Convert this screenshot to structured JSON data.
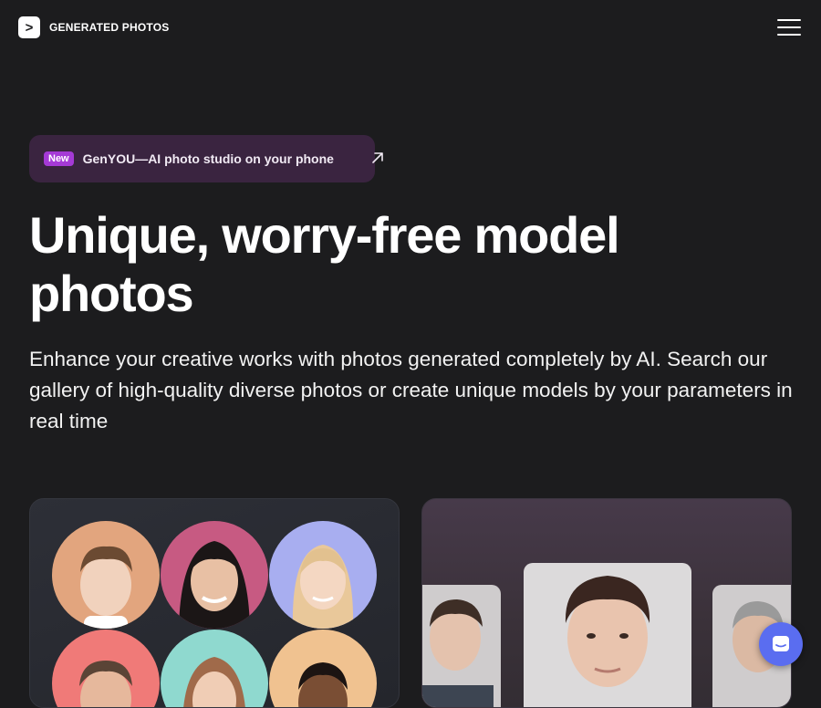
{
  "header": {
    "logo_glyph": ">",
    "brand": "GENERATED PHOTOS",
    "menu_icon": "hamburger-menu-icon"
  },
  "promo": {
    "badge": "New",
    "text": "GenYOU—AI photo studio on your phone",
    "icon": "arrow-up-right-icon"
  },
  "hero": {
    "title": "Unique, worry-free model photos",
    "subtitle": "Enhance your creative works with photos generated completely by AI. Search our gallery of high-quality diverse photos or create unique models by your parameters in real time"
  },
  "cards": {
    "gallery": {
      "faces": [
        {
          "bg": "#e2a57e"
        },
        {
          "bg": "#c75a82"
        },
        {
          "bg": "#a8aef0"
        },
        {
          "bg": "#f07a78"
        },
        {
          "bg": "#8fd9cf"
        },
        {
          "bg": "#f0c290"
        }
      ]
    },
    "generator": {
      "photos": [
        "side-left",
        "main",
        "side-right"
      ]
    }
  },
  "chat": {
    "icon": "chat-bubble-icon"
  },
  "colors": {
    "background": "#1c1c1e",
    "promo_bg": "#3a2440",
    "badge": "#a53ad6",
    "chat_button": "#5a6df0"
  }
}
